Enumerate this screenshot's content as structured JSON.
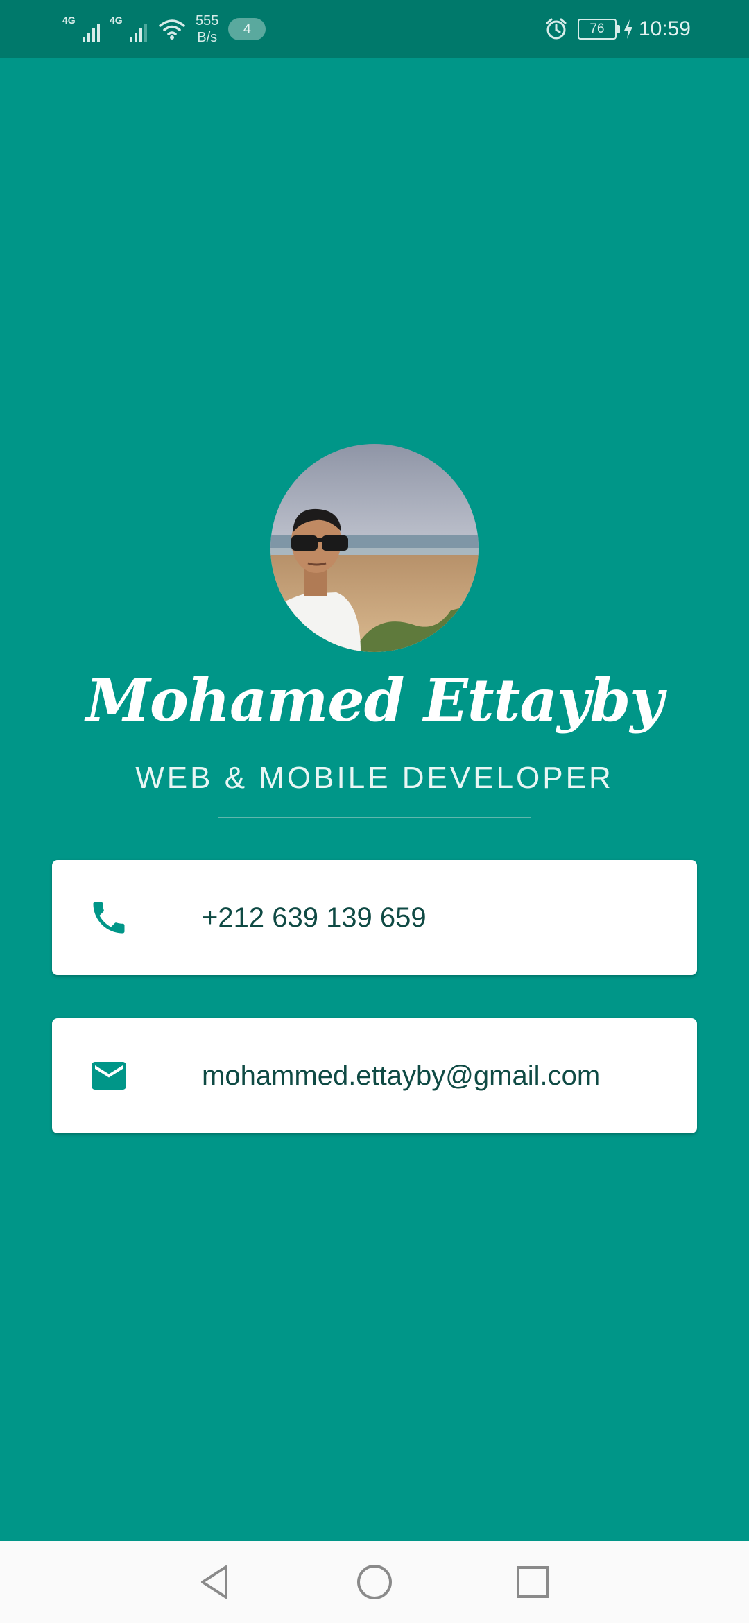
{
  "status_bar": {
    "network_1": "4G",
    "network_2": "4G",
    "speed_value": "555",
    "speed_unit": "B/s",
    "notification_count": "4",
    "battery_level": "76",
    "time": "10:59"
  },
  "profile": {
    "name": "Mohamed Ettayby",
    "title": "WEB & MOBILE DEVELOPER"
  },
  "contacts": {
    "phone": {
      "icon": "phone-icon",
      "value": "+212 639 139 659"
    },
    "email": {
      "icon": "email-icon",
      "value": "mohammed.ettayby@gmail.com"
    }
  },
  "colors": {
    "background": "#009688",
    "status_bar": "#00796b",
    "card": "#ffffff",
    "card_text": "#0f4a44",
    "icon": "#009688"
  },
  "nav": {
    "back_icon": "triangle-back-icon",
    "home_icon": "circle-home-icon",
    "recents_icon": "square-recents-icon"
  }
}
